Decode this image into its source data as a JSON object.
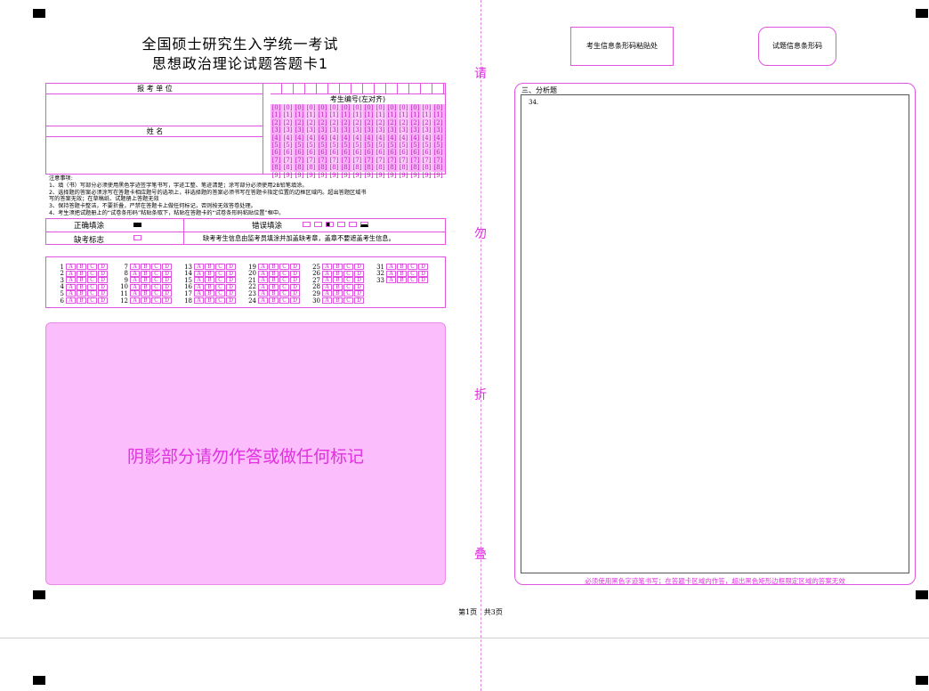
{
  "header": {
    "title_line1": "全国硕士研究生入学统一考试",
    "title_line2": "思想政治理论试题答题卡1",
    "barcode_box1": "考生信息条形码粘贴处",
    "barcode_box2": "试题信息条形码"
  },
  "fold_chars": [
    "请",
    "勿",
    "折",
    "叠"
  ],
  "info": {
    "unit_label": "报 考 单 位",
    "name_label": "姓          名",
    "exam_no_label": "考生编号(左对齐)",
    "digits": [
      "0",
      "1",
      "2",
      "3",
      "4",
      "5",
      "6",
      "7",
      "8",
      "9"
    ]
  },
  "notes": {
    "heading": "注意事项:",
    "items": [
      "1、填（书）写部分必须使用黑色字迹签字笔书写，字迹工整、笔迹清楚；涂写部分必须使用2B铅笔填涂。",
      "2、选择题的答案必须涂写在答题卡相应题号的选项上，非选择题的答案必须书写在答题卡指定位置的边框区域内。超出答题区域书",
      "   写的答案无效；在草稿纸、试题册上答题无效",
      "3、保持答题卡整洁，不要折叠，严禁在答题卡上做任何标记，否则按无效答卷处理。",
      "4、考生须把试题册上的“试卷条形码”粘贴条取下，粘贴在答题卡的“试卷条形码粘贴位置”框中。"
    ]
  },
  "fill": {
    "correct_label": "正确填涂",
    "wrong_label": "错误填涂",
    "absent_label": "缺考标志",
    "absent_note": "缺考考生信息由监考员填涂并加盖缺考章，盖章不要遮盖考生信息。"
  },
  "choice": {
    "options": [
      "A",
      "B",
      "C",
      "D"
    ],
    "columns": [
      [
        "1",
        "2",
        "3",
        "4",
        "5",
        "6"
      ],
      [
        "7",
        "8",
        "9",
        "10",
        "11",
        "12"
      ],
      [
        "13",
        "14",
        "15",
        "16",
        "17",
        "18"
      ],
      [
        "19",
        "20",
        "21",
        "22",
        "23",
        "24"
      ],
      [
        "25",
        "26",
        "27",
        "28",
        "29",
        "30"
      ],
      [
        "31",
        "32",
        "33"
      ]
    ]
  },
  "shaded_notice": "阴影部分请勿作答或做任何标记",
  "right": {
    "section_title": "三、分析题",
    "question_no": "34.",
    "footer_warning": "必须使用黑色字迹笔书写；在答题卡区域内作答，超出黑色矩形边框限定区域的答案无效"
  },
  "page_footer": "第1页   共3页",
  "colors": {
    "accent": "#e255e2",
    "shade": "#fbbcfb",
    "text_pink": "#e030e0"
  }
}
